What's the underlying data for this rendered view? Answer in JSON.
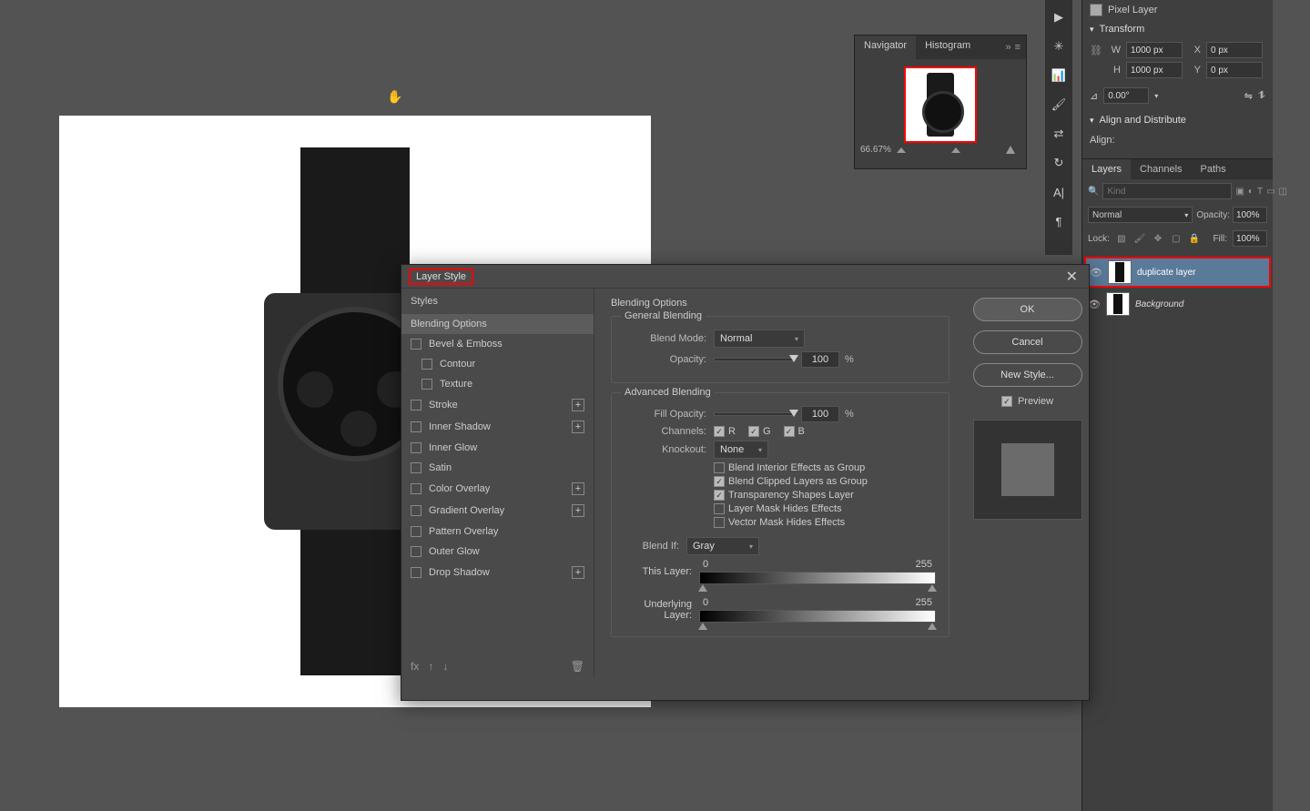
{
  "canvas_cursor": "✋",
  "navigator": {
    "tabs": [
      "Navigator",
      "Histogram"
    ],
    "zoom": "66.67%"
  },
  "properties": {
    "pixel_layer_label": "Pixel Layer",
    "transform_label": "Transform",
    "W_label": "W",
    "W_value": "1000 px",
    "H_label": "H",
    "H_value": "1000 px",
    "X_label": "X",
    "X_value": "0 px",
    "Y_label": "Y",
    "Y_value": "0 px",
    "angle_icon": "⊿",
    "angle_value": "0.00°",
    "align_label": "Align and Distribute",
    "align_sub": "Align:"
  },
  "layers_panel": {
    "tabs": [
      "Layers",
      "Channels",
      "Paths"
    ],
    "search_placeholder": "Kind",
    "search_icon": "🔍",
    "mode_value": "Normal",
    "opacity_label": "Opacity:",
    "opacity_value": "100%",
    "lock_label": "Lock:",
    "fill_label": "Fill:",
    "fill_value": "100%",
    "items": [
      {
        "name": "duplicate layer",
        "highlight": true
      },
      {
        "name": "Background",
        "highlight": false
      }
    ]
  },
  "dialog": {
    "title": "Layer Style",
    "styles_header": "Styles",
    "styles": [
      {
        "label": "Blending Options",
        "kind": "header",
        "active": true
      },
      {
        "label": "Bevel & Emboss",
        "cb": true
      },
      {
        "label": "Contour",
        "cb": true,
        "sub": true
      },
      {
        "label": "Texture",
        "cb": true,
        "sub": true
      },
      {
        "label": "Stroke",
        "cb": true,
        "plus": true
      },
      {
        "label": "Inner Shadow",
        "cb": true,
        "plus": true
      },
      {
        "label": "Inner Glow",
        "cb": true
      },
      {
        "label": "Satin",
        "cb": true
      },
      {
        "label": "Color Overlay",
        "cb": true,
        "plus": true
      },
      {
        "label": "Gradient Overlay",
        "cb": true,
        "plus": true
      },
      {
        "label": "Pattern Overlay",
        "cb": true
      },
      {
        "label": "Outer Glow",
        "cb": true
      },
      {
        "label": "Drop Shadow",
        "cb": true,
        "plus": true
      }
    ],
    "options": {
      "title": "Blending Options",
      "general_legend": "General Blending",
      "advanced_legend": "Advanced Blending",
      "blend_mode_label": "Blend Mode:",
      "blend_mode_value": "Normal",
      "opacity_label": "Opacity:",
      "opacity_value": "100",
      "fill_opacity_label": "Fill Opacity:",
      "fill_opacity_value": "100",
      "channels_label": "Channels:",
      "ch_R": "R",
      "ch_G": "G",
      "ch_B": "B",
      "knockout_label": "Knockout:",
      "knockout_value": "None",
      "adv_opts": [
        {
          "label": "Blend Interior Effects as Group",
          "checked": false
        },
        {
          "label": "Blend Clipped Layers as Group",
          "checked": true
        },
        {
          "label": "Transparency Shapes Layer",
          "checked": true
        },
        {
          "label": "Layer Mask Hides Effects",
          "checked": false
        },
        {
          "label": "Vector Mask Hides Effects",
          "checked": false
        }
      ],
      "blend_if_label": "Blend If:",
      "blend_if_value": "Gray",
      "this_layer_label": "This Layer:",
      "this_layer_low": "0",
      "this_layer_high": "255",
      "under_label": "Underlying Layer:",
      "under_low": "0",
      "under_high": "255",
      "pct": "%"
    },
    "buttons": {
      "ok": "OK",
      "cancel": "Cancel",
      "new_style": "New Style...",
      "preview": "Preview"
    },
    "footer_icons": {
      "fx": "fx",
      "up": "↑",
      "down": "↓",
      "trash": "🗑"
    }
  }
}
